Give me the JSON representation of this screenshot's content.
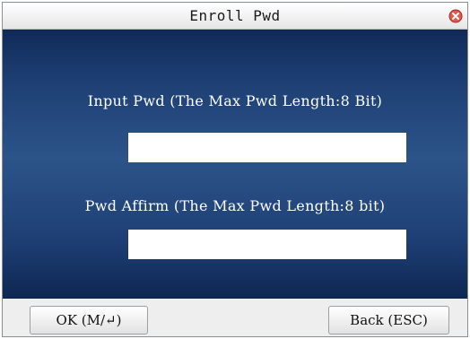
{
  "window": {
    "title": "Enroll Pwd",
    "close_icon": "close-icon"
  },
  "form": {
    "input_pwd_label": "Input Pwd (The Max Pwd Length:8 Bit)",
    "input_pwd_value": "",
    "pwd_affirm_label": "Pwd Affirm (The Max Pwd Length:8 bit)",
    "pwd_affirm_value": ""
  },
  "buttons": {
    "ok_label": "OK (M/↵)",
    "back_label": "Back (ESC)"
  },
  "colors": {
    "screen_background": "#2c5489",
    "close_icon": "#e35a4b"
  }
}
